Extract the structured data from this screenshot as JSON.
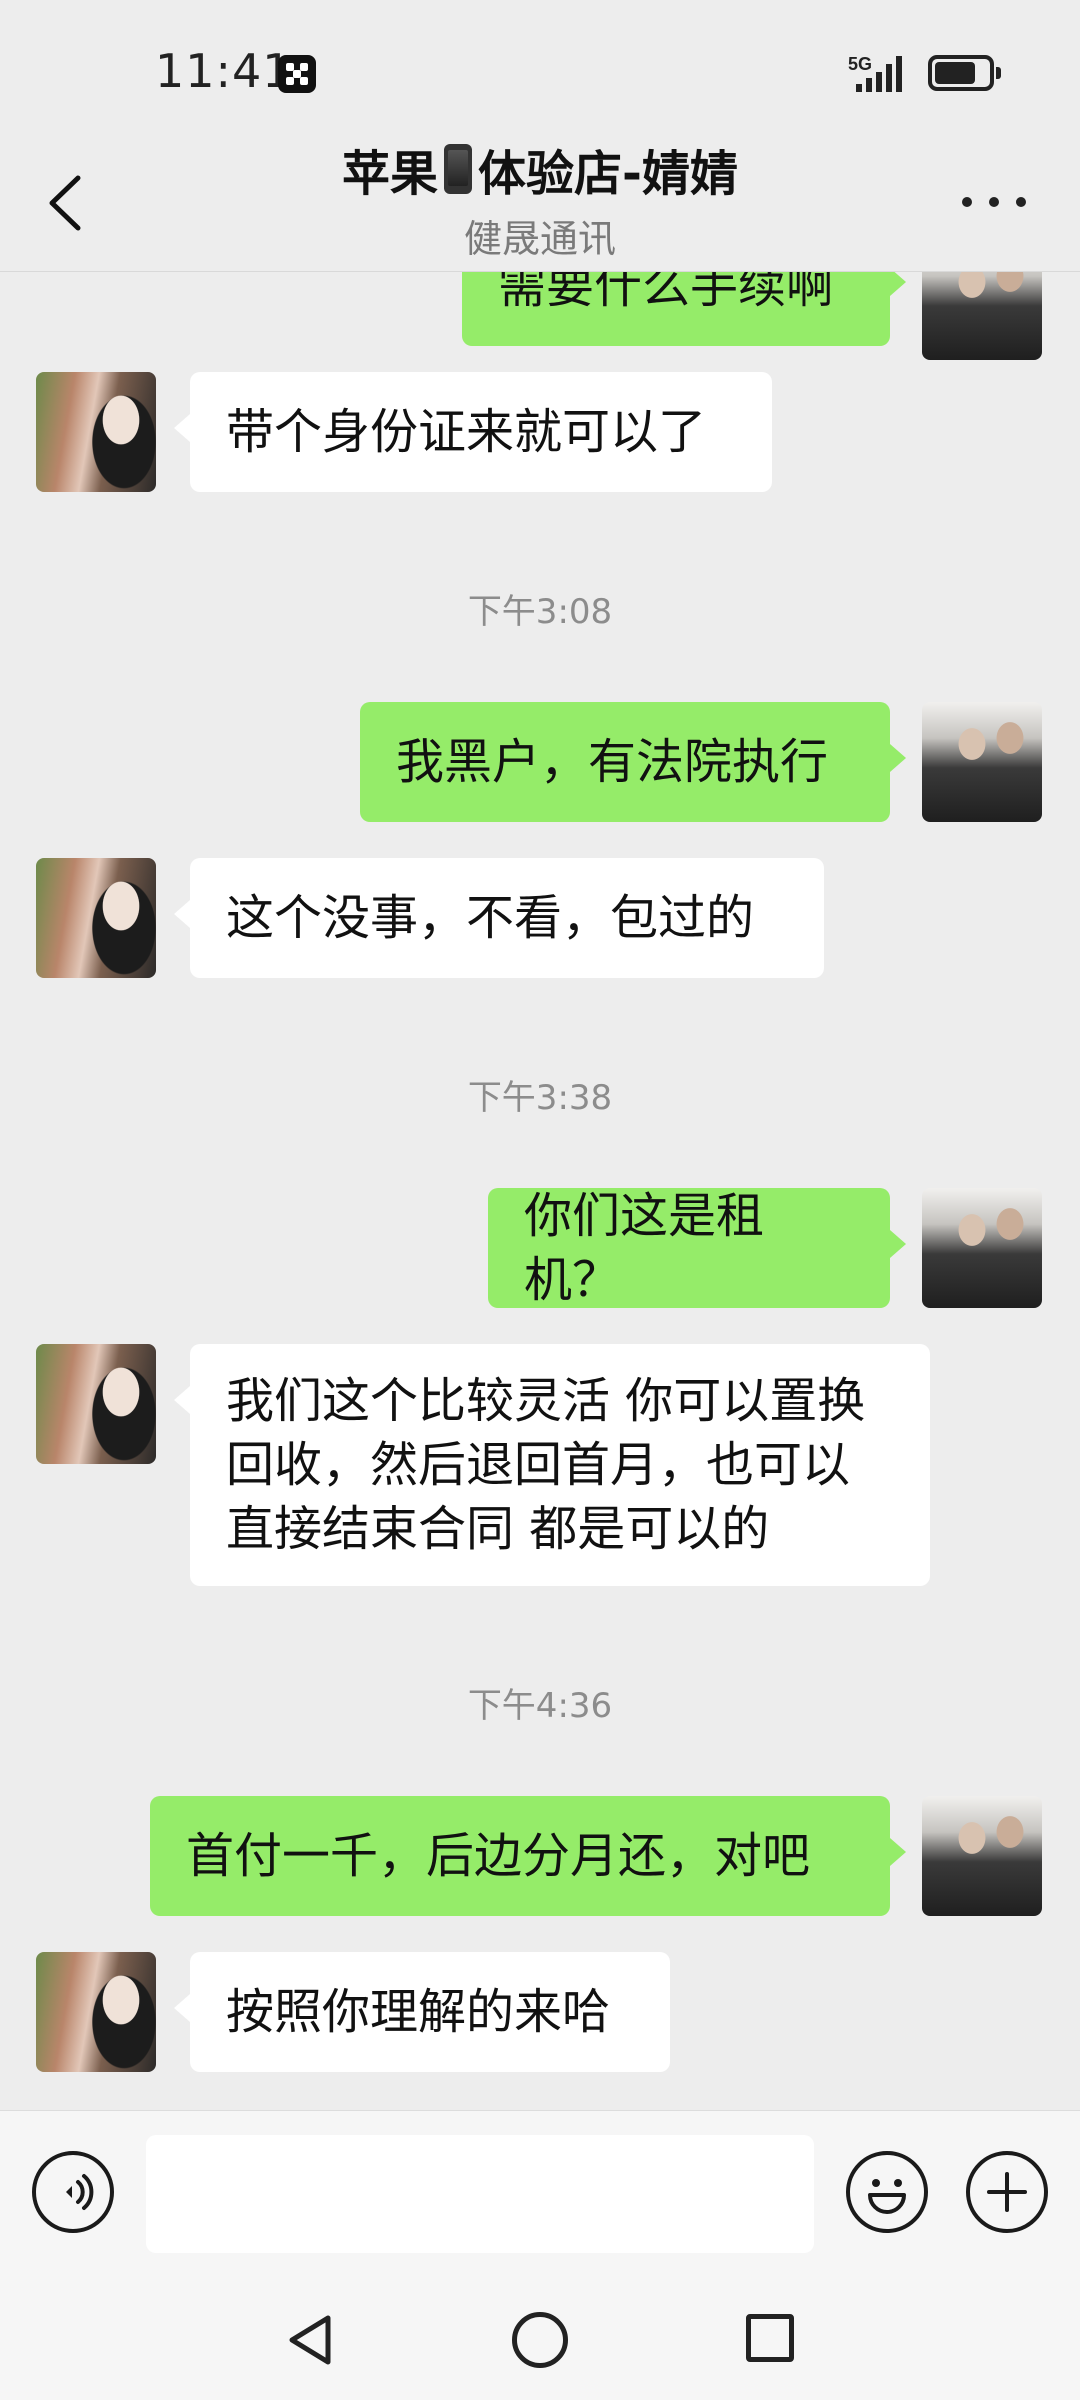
{
  "status_bar": {
    "time": "11:41",
    "network": "5G",
    "app_icon": "grid-app-icon",
    "battery_icon": "battery-icon"
  },
  "header": {
    "title_prefix": "苹果",
    "title_suffix": "体验店-婧婧",
    "title_emoji": "mobile-phone-emoji",
    "subtitle": "健晟通讯",
    "back_icon": "chevron-left-icon",
    "more_icon": "more-dots-icon"
  },
  "messages": [
    {
      "side": "out",
      "text": "需要什么手续啊"
    },
    {
      "side": "in",
      "text": "带个身份证来就可以了"
    },
    {
      "type": "time",
      "text": "下午3:08"
    },
    {
      "side": "out",
      "text": "我黑户，有法院执行"
    },
    {
      "side": "in",
      "text": "这个没事，不看，包过的"
    },
    {
      "type": "time",
      "text": "下午3:38"
    },
    {
      "side": "out",
      "text": "你们这是租机？"
    },
    {
      "side": "in",
      "text": "我们这个比较灵活 你可以置换\n回收，然后退回首月，也可以\n直接结束合同 都是可以的"
    },
    {
      "type": "time",
      "text": "下午4:36"
    },
    {
      "side": "out",
      "text": "首付一千，后边分月还，对吧"
    },
    {
      "side": "in",
      "text": "按照你理解的来哈"
    }
  ],
  "input_bar": {
    "value": "",
    "voice_icon": "voice-icon",
    "emoji_icon": "emoji-icon",
    "plus_icon": "plus-icon"
  },
  "colors": {
    "background": "#ededed",
    "bubble_out": "#95ec69",
    "bubble_in": "#ffffff",
    "timestamp": "#8c8c8c"
  }
}
